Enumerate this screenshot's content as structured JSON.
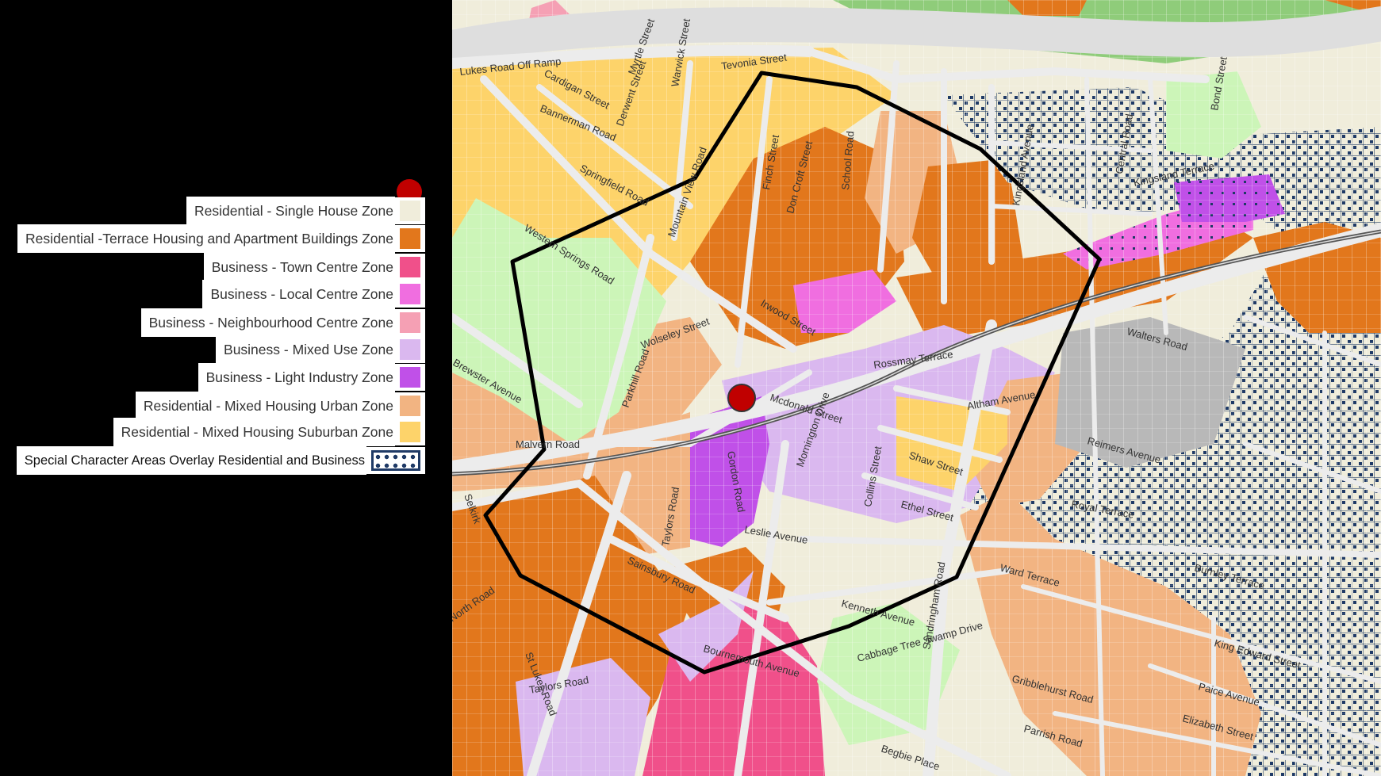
{
  "colors": {
    "single_house": "#f0eddb",
    "terrace_housing": "#e2771c",
    "town_centre": "#f0508a",
    "local_centre": "#f06ee0",
    "neighbourhood_centre": "#f5a0b4",
    "mixed_use": "#dab8ef",
    "light_industry": "#c050e8",
    "mixed_housing_urban": "#f2b482",
    "mixed_housing_suburban": "#fdd36a",
    "special_character": "#1f3a66",
    "open_space": "#ccf5b8",
    "green": "#8fcc7a",
    "road": "#e8e8e8",
    "boundary": "#000000",
    "marker": "#c00000"
  },
  "legend": {
    "items": [
      {
        "label": "Residential - Single House Zone",
        "color_key": "single_house"
      },
      {
        "label": "Residential -Terrace Housing and Apartment Buildings Zone",
        "color_key": "terrace_housing"
      },
      {
        "label": "Business - Town Centre Zone",
        "color_key": "town_centre"
      },
      {
        "label": "Business - Local Centre Zone",
        "color_key": "local_centre"
      },
      {
        "label": "Business - Neighbourhood Centre Zone",
        "color_key": "neighbourhood_centre"
      },
      {
        "label": "Business - Mixed Use Zone",
        "color_key": "mixed_use"
      },
      {
        "label": "Business - Light Industry Zone",
        "color_key": "light_industry"
      },
      {
        "label": "Residential - Mixed Housing Urban Zone",
        "color_key": "mixed_housing_urban"
      },
      {
        "label": "Residential - Mixed Housing Suburban Zone",
        "color_key": "mixed_housing_suburban"
      },
      {
        "label": "Special Character Areas Overlay Residential and Business",
        "color_key": "special_character"
      }
    ]
  },
  "streets": [
    {
      "name": "Lukes Road Off Ramp"
    },
    {
      "name": "Cardigan Street"
    },
    {
      "name": "Myrtle Street"
    },
    {
      "name": "Warwick Street"
    },
    {
      "name": "Tevonia Street"
    },
    {
      "name": "Bannerman Road"
    },
    {
      "name": "Derwent Street"
    },
    {
      "name": "Springfield Road"
    },
    {
      "name": "Western Springs Road"
    },
    {
      "name": "Mountain View Road"
    },
    {
      "name": "Finch Street"
    },
    {
      "name": "Don Croft Street"
    },
    {
      "name": "School Road"
    },
    {
      "name": "Kingsland Avenue"
    },
    {
      "name": "Central Road"
    },
    {
      "name": "Bond Street"
    },
    {
      "name": "Kingsland Terrace"
    },
    {
      "name": "Irwood Street"
    },
    {
      "name": "Wolseley Street"
    },
    {
      "name": "Parkhill Road"
    },
    {
      "name": "Brewster Avenue"
    },
    {
      "name": "Malvern Road"
    },
    {
      "name": "Rossmay Terrace"
    },
    {
      "name": "Mcdonald Street"
    },
    {
      "name": "Altham Avenue"
    },
    {
      "name": "Walters Road"
    },
    {
      "name": "Reimers Avenue"
    },
    {
      "name": "Shaw Street"
    },
    {
      "name": "Ethel Street"
    },
    {
      "name": "Collins Street"
    },
    {
      "name": "Mornington Drive"
    },
    {
      "name": "Gordon Road"
    },
    {
      "name": "Taylors Road"
    },
    {
      "name": "Selkirk"
    },
    {
      "name": "North Road"
    },
    {
      "name": "Sainsbury Road"
    },
    {
      "name": "Leslie Avenue"
    },
    {
      "name": "Ward Terrace"
    },
    {
      "name": "Royal Terrace"
    },
    {
      "name": "Kenneth Avenue"
    },
    {
      "name": "Bournemouth Avenue"
    },
    {
      "name": "Cabbage Tree Swamp Drive"
    },
    {
      "name": "Sandringham Road"
    },
    {
      "name": "Gribblehurst Road"
    },
    {
      "name": "St Lukes Road"
    },
    {
      "name": "Taylors Road"
    },
    {
      "name": "Parrish Road"
    },
    {
      "name": "Elizabeth Street"
    },
    {
      "name": "Begbie Place"
    },
    {
      "name": "Paice Avenue"
    },
    {
      "name": "King Edward Street"
    },
    {
      "name": "Burnley Terrace"
    }
  ]
}
